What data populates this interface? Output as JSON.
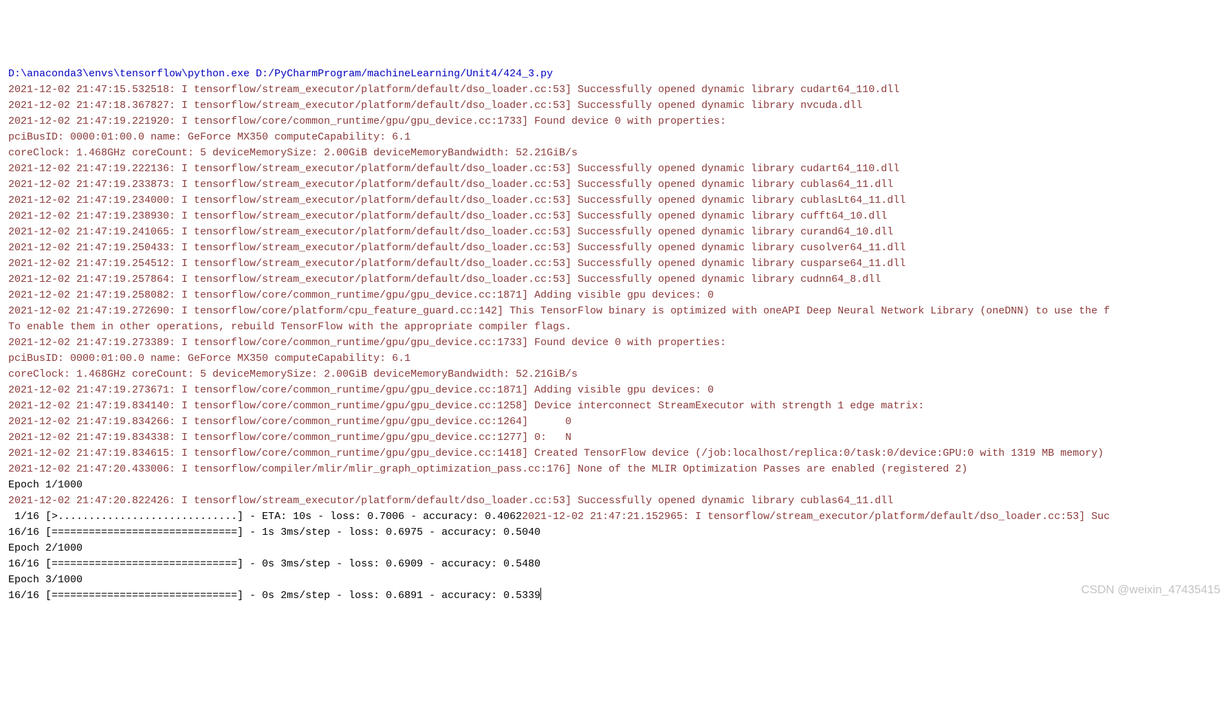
{
  "lines": [
    {
      "cls": "cmd",
      "text": "D:\\anaconda3\\envs\\tensorflow\\python.exe D:/PyCharmProgram/machineLearning/Unit4/424_3.py"
    },
    {
      "cls": "log",
      "text": "2021-12-02 21:47:15.532518: I tensorflow/stream_executor/platform/default/dso_loader.cc:53] Successfully opened dynamic library cudart64_110.dll"
    },
    {
      "cls": "log",
      "text": "2021-12-02 21:47:18.367827: I tensorflow/stream_executor/platform/default/dso_loader.cc:53] Successfully opened dynamic library nvcuda.dll"
    },
    {
      "cls": "log",
      "text": "2021-12-02 21:47:19.221920: I tensorflow/core/common_runtime/gpu/gpu_device.cc:1733] Found device 0 with properties: "
    },
    {
      "cls": "log",
      "text": "pciBusID: 0000:01:00.0 name: GeForce MX350 computeCapability: 6.1"
    },
    {
      "cls": "log",
      "text": "coreClock: 1.468GHz coreCount: 5 deviceMemorySize: 2.00GiB deviceMemoryBandwidth: 52.21GiB/s"
    },
    {
      "cls": "log",
      "text": "2021-12-02 21:47:19.222136: I tensorflow/stream_executor/platform/default/dso_loader.cc:53] Successfully opened dynamic library cudart64_110.dll"
    },
    {
      "cls": "log",
      "text": "2021-12-02 21:47:19.233873: I tensorflow/stream_executor/platform/default/dso_loader.cc:53] Successfully opened dynamic library cublas64_11.dll"
    },
    {
      "cls": "log",
      "text": "2021-12-02 21:47:19.234000: I tensorflow/stream_executor/platform/default/dso_loader.cc:53] Successfully opened dynamic library cublasLt64_11.dll"
    },
    {
      "cls": "log",
      "text": "2021-12-02 21:47:19.238930: I tensorflow/stream_executor/platform/default/dso_loader.cc:53] Successfully opened dynamic library cufft64_10.dll"
    },
    {
      "cls": "log",
      "text": "2021-12-02 21:47:19.241065: I tensorflow/stream_executor/platform/default/dso_loader.cc:53] Successfully opened dynamic library curand64_10.dll"
    },
    {
      "cls": "log",
      "text": "2021-12-02 21:47:19.250433: I tensorflow/stream_executor/platform/default/dso_loader.cc:53] Successfully opened dynamic library cusolver64_11.dll"
    },
    {
      "cls": "log",
      "text": "2021-12-02 21:47:19.254512: I tensorflow/stream_executor/platform/default/dso_loader.cc:53] Successfully opened dynamic library cusparse64_11.dll"
    },
    {
      "cls": "log",
      "text": "2021-12-02 21:47:19.257864: I tensorflow/stream_executor/platform/default/dso_loader.cc:53] Successfully opened dynamic library cudnn64_8.dll"
    },
    {
      "cls": "log",
      "text": "2021-12-02 21:47:19.258082: I tensorflow/core/common_runtime/gpu/gpu_device.cc:1871] Adding visible gpu devices: 0"
    },
    {
      "cls": "log",
      "text": "2021-12-02 21:47:19.272690: I tensorflow/core/platform/cpu_feature_guard.cc:142] This TensorFlow binary is optimized with oneAPI Deep Neural Network Library (oneDNN) to use the f"
    },
    {
      "cls": "log",
      "text": "To enable them in other operations, rebuild TensorFlow with the appropriate compiler flags."
    },
    {
      "cls": "log",
      "text": "2021-12-02 21:47:19.273389: I tensorflow/core/common_runtime/gpu/gpu_device.cc:1733] Found device 0 with properties: "
    },
    {
      "cls": "log",
      "text": "pciBusID: 0000:01:00.0 name: GeForce MX350 computeCapability: 6.1"
    },
    {
      "cls": "log",
      "text": "coreClock: 1.468GHz coreCount: 5 deviceMemorySize: 2.00GiB deviceMemoryBandwidth: 52.21GiB/s"
    },
    {
      "cls": "log",
      "text": "2021-12-02 21:47:19.273671: I tensorflow/core/common_runtime/gpu/gpu_device.cc:1871] Adding visible gpu devices: 0"
    },
    {
      "cls": "log",
      "text": "2021-12-02 21:47:19.834140: I tensorflow/core/common_runtime/gpu/gpu_device.cc:1258] Device interconnect StreamExecutor with strength 1 edge matrix:"
    },
    {
      "cls": "log",
      "text": "2021-12-02 21:47:19.834266: I tensorflow/core/common_runtime/gpu/gpu_device.cc:1264]      0 "
    },
    {
      "cls": "log",
      "text": "2021-12-02 21:47:19.834338: I tensorflow/core/common_runtime/gpu/gpu_device.cc:1277] 0:   N "
    },
    {
      "cls": "log",
      "text": "2021-12-02 21:47:19.834615: I tensorflow/core/common_runtime/gpu/gpu_device.cc:1418] Created TensorFlow device (/job:localhost/replica:0/task:0/device:GPU:0 with 1319 MB memory)"
    },
    {
      "cls": "log",
      "text": "2021-12-02 21:47:20.433006: I tensorflow/compiler/mlir/mlir_graph_optimization_pass.cc:176] None of the MLIR Optimization Passes are enabled (registered 2)"
    },
    {
      "cls": "out",
      "text": "Epoch 1/1000"
    },
    {
      "cls": "log",
      "text": "2021-12-02 21:47:20.822426: I tensorflow/stream_executor/platform/default/dso_loader.cc:53] Successfully opened dynamic library cublas64_11.dll"
    },
    {
      "cls": "mix",
      "parts": [
        {
          "cls": "out",
          "text": " 1/16 [>.............................] - ETA: 10s - loss: 0.7006 - accuracy: 0.4062"
        },
        {
          "cls": "log",
          "text": "2021-12-02 21:47:21.152965: I tensorflow/stream_executor/platform/default/dso_loader.cc:53] Suc"
        }
      ]
    },
    {
      "cls": "out",
      "text": "16/16 [==============================] - 1s 3ms/step - loss: 0.6975 - accuracy: 0.5040"
    },
    {
      "cls": "out",
      "text": "Epoch 2/1000"
    },
    {
      "cls": "out",
      "text": "16/16 [==============================] - 0s 3ms/step - loss: 0.6909 - accuracy: 0.5480"
    },
    {
      "cls": "out",
      "text": "Epoch 3/1000"
    },
    {
      "cls": "out",
      "text": "16/16 [==============================] - 0s 2ms/step - loss: 0.6891 - accuracy: 0.5339",
      "cursor": true
    }
  ],
  "watermark": "CSDN @weixin_47435415"
}
